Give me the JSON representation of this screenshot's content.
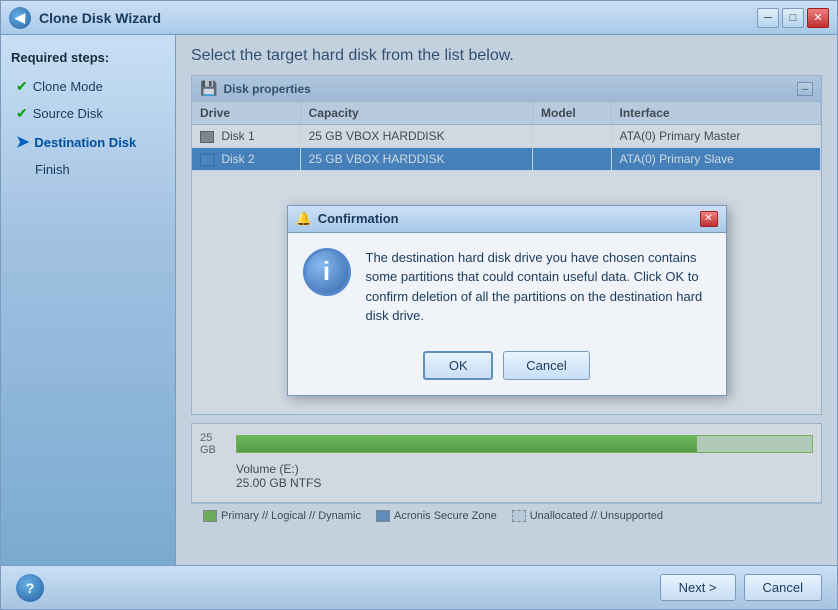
{
  "titleBar": {
    "title": "Clone Disk Wizard",
    "icon": "◀",
    "buttons": {
      "minimize": "─",
      "maximize": "□",
      "close": "✕"
    }
  },
  "sidebar": {
    "title": "Required steps:",
    "items": [
      {
        "id": "clone-mode",
        "label": "Clone Mode",
        "status": "done"
      },
      {
        "id": "source-disk",
        "label": "Source Disk",
        "status": "done"
      },
      {
        "id": "destination-disk",
        "label": "Destination Disk",
        "status": "current"
      },
      {
        "id": "finish",
        "label": "Finish",
        "status": "none"
      }
    ]
  },
  "mainPanel": {
    "title": "Select the target hard disk from the list below.",
    "diskProperties": {
      "headerLabel": "Disk properties",
      "columns": [
        "Drive",
        "Capacity",
        "Model",
        "Interface"
      ],
      "rows": [
        {
          "drive": "Disk 1",
          "capacity": "25 GB",
          "model": "VBOX HARDDISK",
          "interface": "ATA(0) Primary Master",
          "selected": false
        },
        {
          "drive": "Disk 2",
          "capacity": "25 GB",
          "model": "VBOX HARDDISK",
          "interface": "ATA(0) Primary Slave",
          "selected": true
        }
      ]
    },
    "bottomInfo": {
      "sizeLabel": "25 GB",
      "volumeName": "Volume (E:)",
      "volumeSize": "25.00 GB  NTFS"
    },
    "legend": [
      {
        "id": "primary",
        "color": "green",
        "label": "Primary // Logical // Dynamic"
      },
      {
        "id": "acronis",
        "color": "blue",
        "label": "Acronis Secure Zone"
      },
      {
        "id": "unallocated",
        "color": "light",
        "label": "Unallocated // Unsupported"
      }
    ]
  },
  "dialog": {
    "title": "Confirmation",
    "icon": "i",
    "message": "The destination hard disk drive you have chosen contains some partitions that could contain useful data. Click OK to confirm deletion of all the partitions on the destination hard disk drive.",
    "buttons": {
      "ok": "OK",
      "cancel": "Cancel"
    }
  },
  "bottomBar": {
    "nextLabel": "Next >",
    "cancelLabel": "Cancel"
  }
}
